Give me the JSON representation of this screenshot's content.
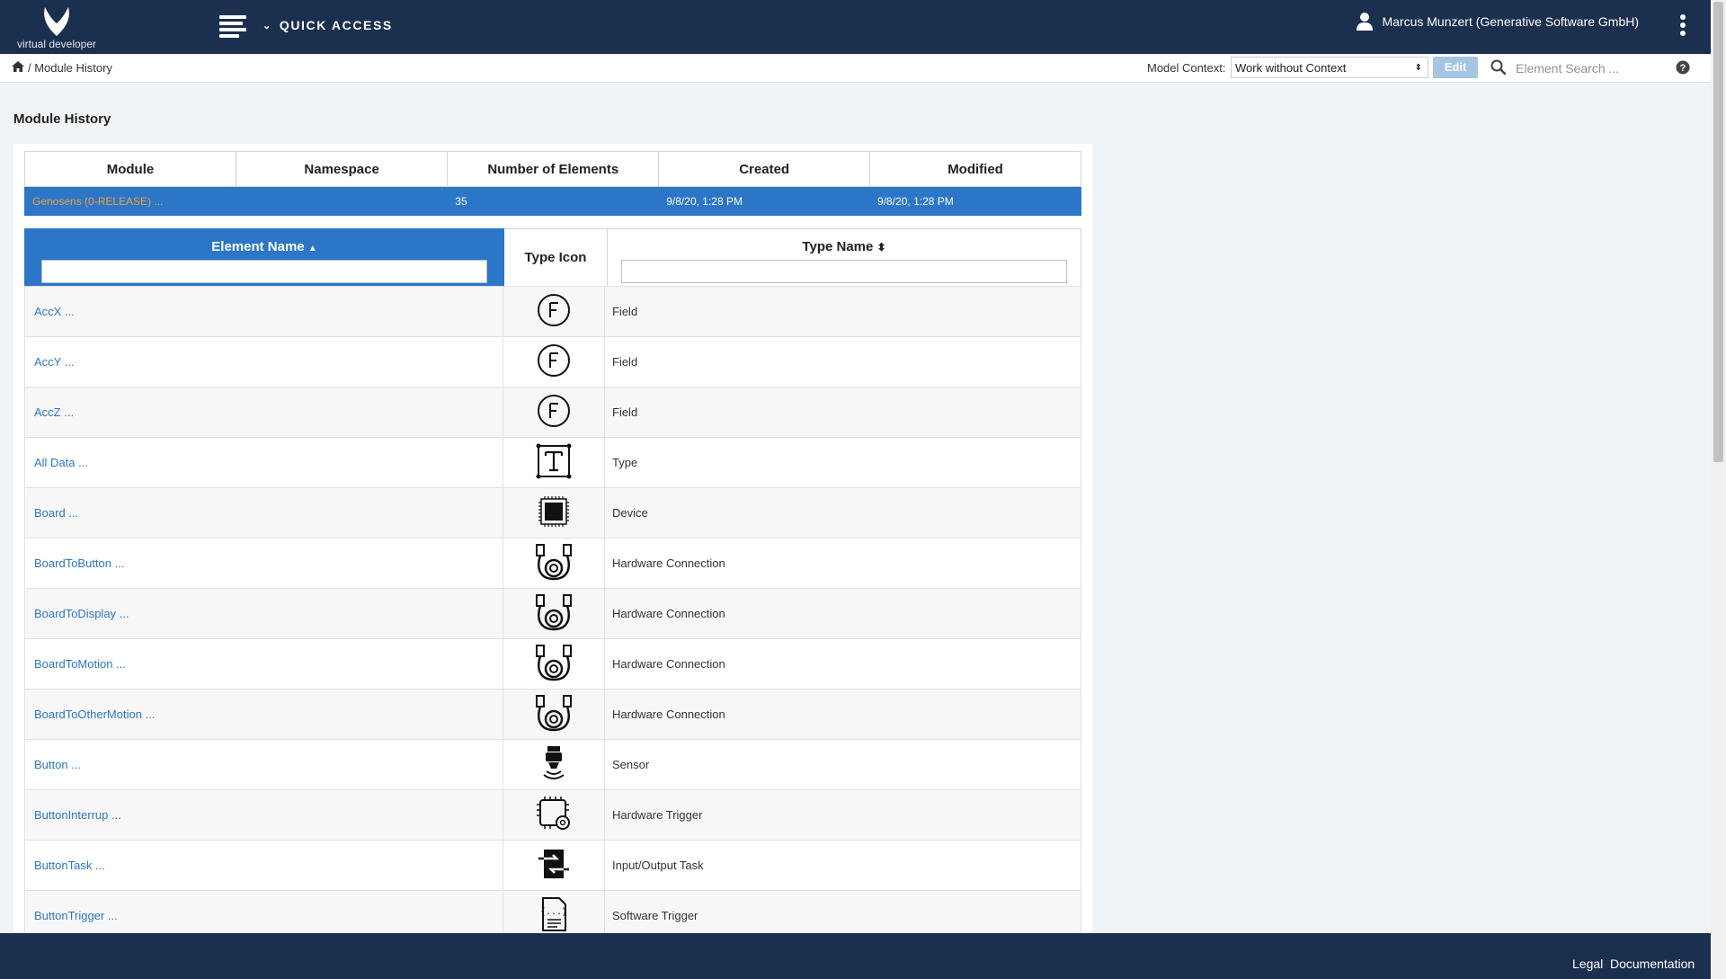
{
  "app": {
    "logo_text": "virtual developer",
    "quick_access": "QUICK ACCESS",
    "user_name": "Marcus Munzert (Generative Software GmbH)"
  },
  "breadcrumb": {
    "current": "/ Module History"
  },
  "context": {
    "label": "Model Context:",
    "selected": "Work without Context",
    "edit_label": "Edit",
    "search_placeholder": "Element Search ..."
  },
  "page": {
    "title": "Module History"
  },
  "module_table": {
    "headers": [
      "Module",
      "Namespace",
      "Number of Elements",
      "Created",
      "Modified"
    ],
    "row": {
      "module": "Genosens (0-RELEASE) ...",
      "namespace": "",
      "count": "35",
      "created": "9/8/20, 1:28 PM",
      "modified": "9/8/20, 1:28 PM"
    }
  },
  "element_table": {
    "headers": {
      "name": "Element Name",
      "name_sort": "▲",
      "icon": "Type Icon",
      "type": "Type Name",
      "type_sort": "⬍"
    },
    "rows": [
      {
        "name": "AccX ...",
        "icon": "field-icon",
        "type": "Field"
      },
      {
        "name": "AccY ...",
        "icon": "field-icon",
        "type": "Field"
      },
      {
        "name": "AccZ ...",
        "icon": "field-icon",
        "type": "Field"
      },
      {
        "name": "All Data ...",
        "icon": "type-icon",
        "type": "Type"
      },
      {
        "name": "Board ...",
        "icon": "device-icon",
        "type": "Device"
      },
      {
        "name": "BoardToButton ...",
        "icon": "cable-icon",
        "type": "Hardware Connection"
      },
      {
        "name": "BoardToDisplay ...",
        "icon": "cable-icon",
        "type": "Hardware Connection"
      },
      {
        "name": "BoardToMotion ...",
        "icon": "cable-icon",
        "type": "Hardware Connection"
      },
      {
        "name": "BoardToOtherMotion ...",
        "icon": "cable-icon",
        "type": "Hardware Connection"
      },
      {
        "name": "Button ...",
        "icon": "sensor-icon",
        "type": "Sensor"
      },
      {
        "name": "ButtonInterrup ...",
        "icon": "hardware-trigger-icon",
        "type": "Hardware Trigger"
      },
      {
        "name": "ButtonTask ...",
        "icon": "io-task-icon",
        "type": "Input/Output Task"
      },
      {
        "name": "ButtonTrigger ...",
        "icon": "software-trigger-icon",
        "type": "Software Trigger"
      },
      {
        "name": "",
        "icon": "dots-icon",
        "type": ""
      }
    ]
  },
  "footer": {
    "legal": "Legal",
    "documentation": "Documentation"
  },
  "colors": {
    "nav": "#1b2f4e",
    "accent": "#2c76c7",
    "module_link": "#f0a23c"
  }
}
